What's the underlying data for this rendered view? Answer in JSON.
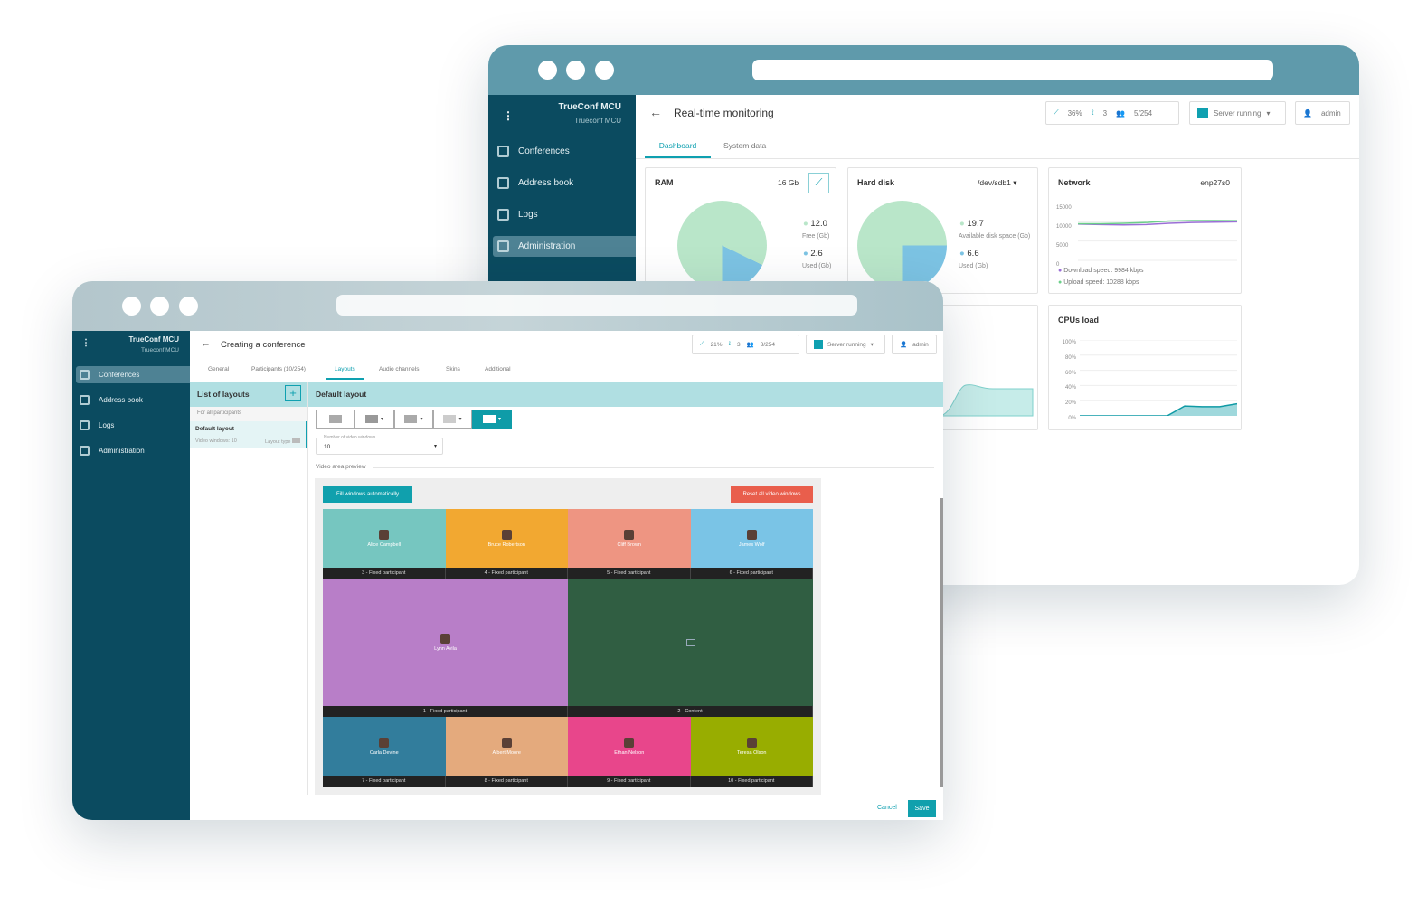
{
  "back": {
    "app_title": "TrueConf MCU",
    "app_subtitle": "Trueconf MCU",
    "nav": [
      {
        "label": "Conferences",
        "icon": "conferences-icon"
      },
      {
        "label": "Address book",
        "icon": "address-book-icon"
      },
      {
        "label": "Logs",
        "icon": "logs-icon"
      },
      {
        "label": "Administration",
        "icon": "administration-icon",
        "active": true
      }
    ],
    "page_title": "Real-time monitoring",
    "stats": {
      "load": "36%",
      "conferences": "3",
      "participants": "5/254"
    },
    "server_status": "Server running",
    "user": "admin",
    "tabs": [
      {
        "label": "Dashboard",
        "active": true
      },
      {
        "label": "System data"
      }
    ],
    "ram": {
      "title": "RAM",
      "total": "16 Gb",
      "free_value": "12.0",
      "free_label": "Free (Gb)",
      "used_value": "2.6",
      "used_label": "Used (Gb)"
    },
    "disk": {
      "title": "Hard disk",
      "device": "/dev/sdb1",
      "free_value": "19.7",
      "free_label": "Available disk space (Gb)",
      "used_value": "6.6",
      "used_label": "Used (Gb)"
    },
    "network": {
      "title": "Network",
      "interface": "enp27s0",
      "yticks": [
        "15000",
        "10000",
        "5000",
        "0"
      ],
      "download": "Download speed: 9984 kbps",
      "upload": "Upload speed: 10288 kbps",
      "download_series": [
        9400,
        9300,
        9200,
        9300,
        9600,
        9800,
        9900,
        9984
      ],
      "upload_series": [
        9500,
        9500,
        9600,
        9800,
        10200,
        10300,
        10300,
        10288
      ]
    },
    "cpu": {
      "title": "CPUs load",
      "yticks": [
        "100%",
        "80%",
        "60%",
        "40%",
        "20%",
        "0%"
      ],
      "series": [
        0,
        0,
        0,
        0,
        0,
        0,
        13,
        12,
        12,
        16
      ]
    },
    "colors": {
      "free": "#b9e6c9",
      "used": "#7cc3e3",
      "download": "#9b6fd6",
      "upload": "#6ccf8a",
      "accent": "#0fa0b0"
    }
  },
  "front": {
    "app_title": "TrueConf MCU",
    "app_subtitle": "Trueconf MCU",
    "nav": [
      {
        "label": "Conferences",
        "active": true
      },
      {
        "label": "Address book"
      },
      {
        "label": "Logs"
      },
      {
        "label": "Administration"
      }
    ],
    "page_title": "Creating a conference",
    "stats": {
      "load": "21%",
      "conferences": "3",
      "participants": "3/254"
    },
    "server_status": "Server running",
    "user": "admin",
    "tabs": [
      {
        "label": "General"
      },
      {
        "label": "Participants (10/254)"
      },
      {
        "label": "Layouts",
        "active": true
      },
      {
        "label": "Audio channels"
      },
      {
        "label": "Skins"
      },
      {
        "label": "Additional"
      }
    ],
    "list_title": "List of layouts",
    "list_group": "For all participants",
    "layout_item": {
      "name": "Default layout",
      "windows": "Video windows: 10",
      "type": "Layout type"
    },
    "layout_title": "Default layout",
    "windows_field": {
      "label": "Number of video windows",
      "value": "10"
    },
    "preview_label": "Video area preview",
    "fill_button": "Fill windows automatically",
    "reset_button": "Reset all video windows",
    "tiles": [
      {
        "name": "Alice Campbell",
        "slot": "3 - Fixed participant",
        "color": "#76c6c0"
      },
      {
        "name": "Bruce Robertson",
        "slot": "4 - Fixed participant",
        "color": "#f2a831"
      },
      {
        "name": "Cliff Brown",
        "slot": "5 - Fixed participant",
        "color": "#ee9582"
      },
      {
        "name": "James Wolf",
        "slot": "6 - Fixed participant",
        "color": "#7ac4e6"
      },
      {
        "name": "Lynn Avila",
        "slot": "1 - Fixed participant",
        "color": "#b87ec8"
      },
      {
        "name": "",
        "slot": "2 - Content",
        "color": "#305e42"
      },
      {
        "name": "Carla Devine",
        "slot": "7 - Fixed participant",
        "color": "#327d9c"
      },
      {
        "name": "Albert Moore",
        "slot": "8 - Fixed participant",
        "color": "#e4aa7d"
      },
      {
        "name": "Ethan Nelson",
        "slot": "9 - Fixed participant",
        "color": "#e8468b"
      },
      {
        "name": "Teresa Olson",
        "slot": "10 - Fixed participant",
        "color": "#98ad00"
      }
    ],
    "cancel": "Cancel",
    "save": "Save"
  }
}
